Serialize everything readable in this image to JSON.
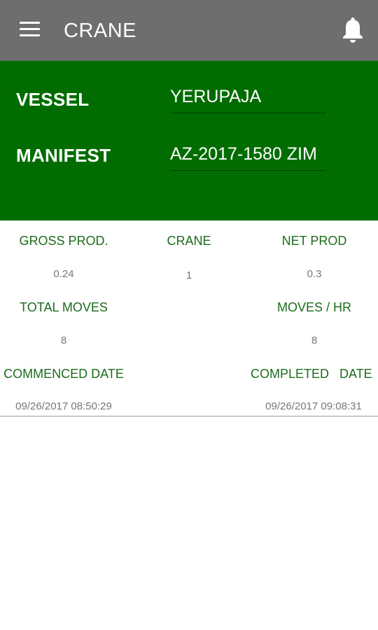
{
  "appbar": {
    "title": "CRANE",
    "menu_icon": "hamburger-menu-icon",
    "bell_icon": "notification-bell-icon",
    "background": "#6e6e6e"
  },
  "header": {
    "background": "#016d01",
    "vessel_label": "VESSEL",
    "vessel_value": "YERUPAJA",
    "manifest_label": "MANIFEST",
    "manifest_value": "AZ-2017-1580 ZIM"
  },
  "stats": {
    "label_color": "#1d6b1d",
    "gross_prod_label": "GROSS PROD.",
    "gross_prod_value": "0.24",
    "crane_label": "CRANE",
    "crane_value": "1",
    "net_prod_label": "NET PROD",
    "net_prod_value": "0.3",
    "total_moves_label": "TOTAL MOVES",
    "total_moves_value": "8",
    "moves_hr_label": "MOVES / HR",
    "moves_hr_value": "8",
    "commenced_label": "COMMENCED DATE",
    "commenced_value": "09/26/2017 08:50:29",
    "completed_label": "COMPLETED   DATE",
    "completed_value": "09/26/2017 09:08:31"
  }
}
